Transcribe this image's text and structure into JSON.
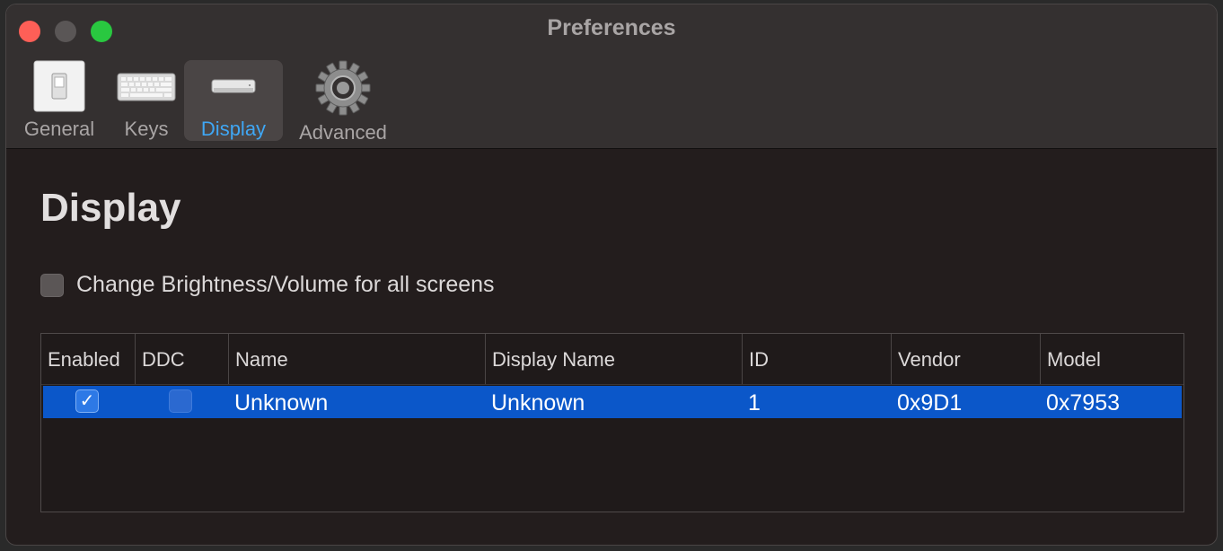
{
  "window": {
    "title": "Preferences"
  },
  "tabs": [
    {
      "label": "General",
      "icon": "light-switch-icon"
    },
    {
      "label": "Keys",
      "icon": "keyboard-icon"
    },
    {
      "label": "Display",
      "icon": "mac-mini-icon",
      "active": true
    },
    {
      "label": "Advanced",
      "icon": "gear-icon"
    }
  ],
  "content": {
    "title": "Display",
    "change_all_screens": {
      "label": "Change Brightness/Volume for all screens",
      "checked": false
    }
  },
  "table": {
    "columns": [
      "Enabled",
      "DDC",
      "Name",
      "Display Name",
      "ID",
      "Vendor",
      "Model"
    ],
    "rows": [
      {
        "enabled": true,
        "ddc": false,
        "name": "Unknown",
        "display_name": "Unknown",
        "id": "1",
        "vendor": "0x9D1",
        "model": "0x7953"
      }
    ]
  },
  "colors": {
    "accent": "#3fa7f5",
    "selection": "#0b57c9",
    "close": "#fe5f57",
    "zoom": "#29c840"
  }
}
